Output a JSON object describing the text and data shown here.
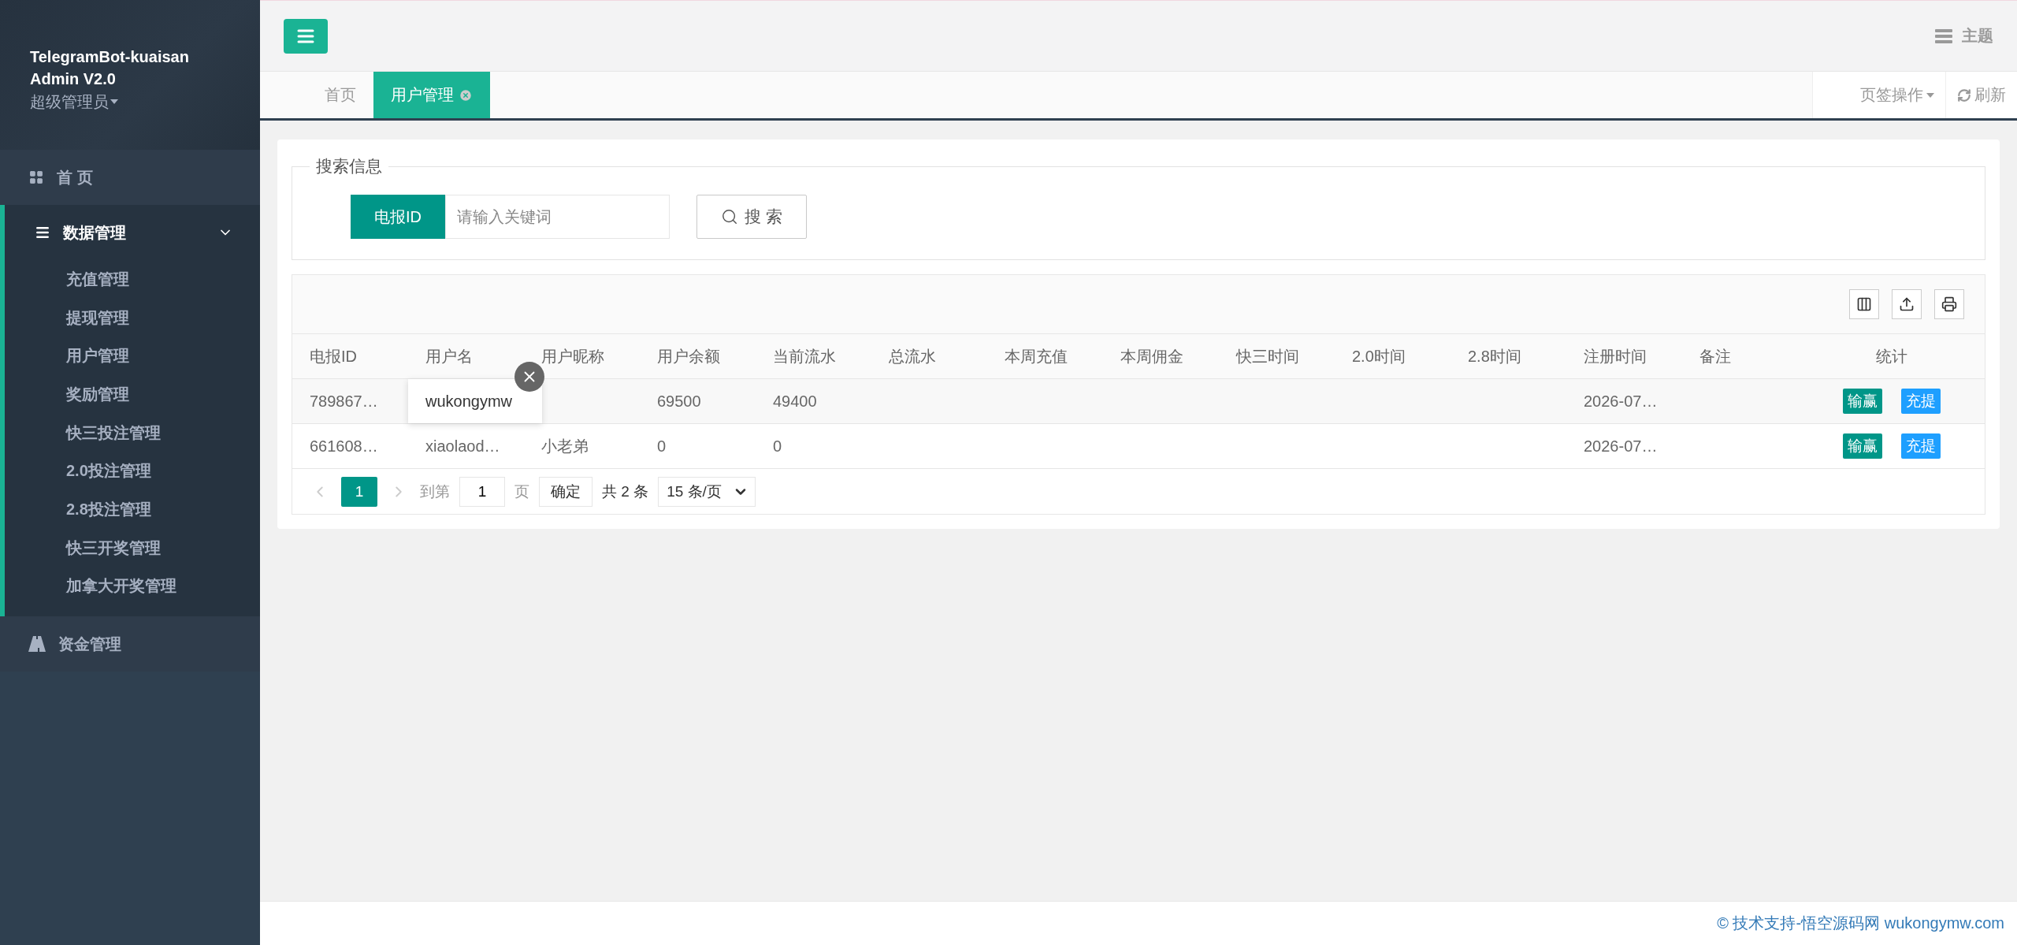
{
  "sidebar": {
    "app_title": [
      "TelegramBot-kuaisan",
      "Admin V2.0"
    ],
    "role": "超级管理员",
    "menu": [
      {
        "label": "首 页",
        "kind": "home",
        "expanded": false
      },
      {
        "label": "数据管理",
        "kind": "data",
        "expanded": true,
        "children": [
          {
            "label": "充值管理"
          },
          {
            "label": "提现管理"
          },
          {
            "label": "用户管理"
          },
          {
            "label": "奖励管理"
          },
          {
            "label": "快三投注管理"
          },
          {
            "label": "2.0投注管理"
          },
          {
            "label": "2.8投注管理"
          },
          {
            "label": "快三开奖管理"
          },
          {
            "label": "加拿大开奖管理"
          }
        ]
      },
      {
        "label": "资金管理",
        "kind": "funds",
        "expanded": false
      }
    ]
  },
  "header": {
    "theme": "主题"
  },
  "tabs": [
    {
      "label": "首页",
      "selected": false,
      "closable": false
    },
    {
      "label": "用户管理",
      "selected": true,
      "closable": true
    }
  ],
  "tab_actions": {
    "menu": "页签操作",
    "refresh": "刷新"
  },
  "search": {
    "legend": "搜索信息",
    "field_label": "电报ID",
    "placeholder": "请输入关键词",
    "button": "搜 索"
  },
  "table": {
    "columns": [
      "电报ID",
      "用户名",
      "用户昵称",
      "用户余额",
      "当前流水",
      "总流水",
      "本周充值",
      "本周佣金",
      "快三时间",
      "2.0时间",
      "2.8时间",
      "注册时间",
      "备注",
      "统计"
    ],
    "rows": [
      {
        "cells": [
          "789867…",
          null,
          null,
          "69500",
          "49400",
          null,
          null,
          null,
          null,
          null,
          null,
          "2026-07…",
          null
        ],
        "popup": "wukongymw",
        "actions": [
          {
            "label": "输赢",
            "color": "#009688"
          },
          {
            "label": "充提",
            "color": "#1e9fff"
          }
        ]
      },
      {
        "cells": [
          "661608…",
          "xiaolaod…",
          "小老弟",
          "0",
          "0",
          null,
          null,
          null,
          null,
          null,
          null,
          "2026-07…",
          null
        ],
        "actions": [
          {
            "label": "输赢",
            "color": "#009688"
          },
          {
            "label": "充提",
            "color": "#1e9fff"
          }
        ]
      }
    ]
  },
  "pager": {
    "pages": [
      {
        "label": "1",
        "selected": true
      }
    ],
    "goto_label": "到第",
    "goto_value": "1",
    "page_unit": "页",
    "confirm": "确定",
    "total": "共 2 条",
    "page_size": "15 条/页"
  },
  "footer": "© 技术支持-悟空源码网 wukongymw.com"
}
